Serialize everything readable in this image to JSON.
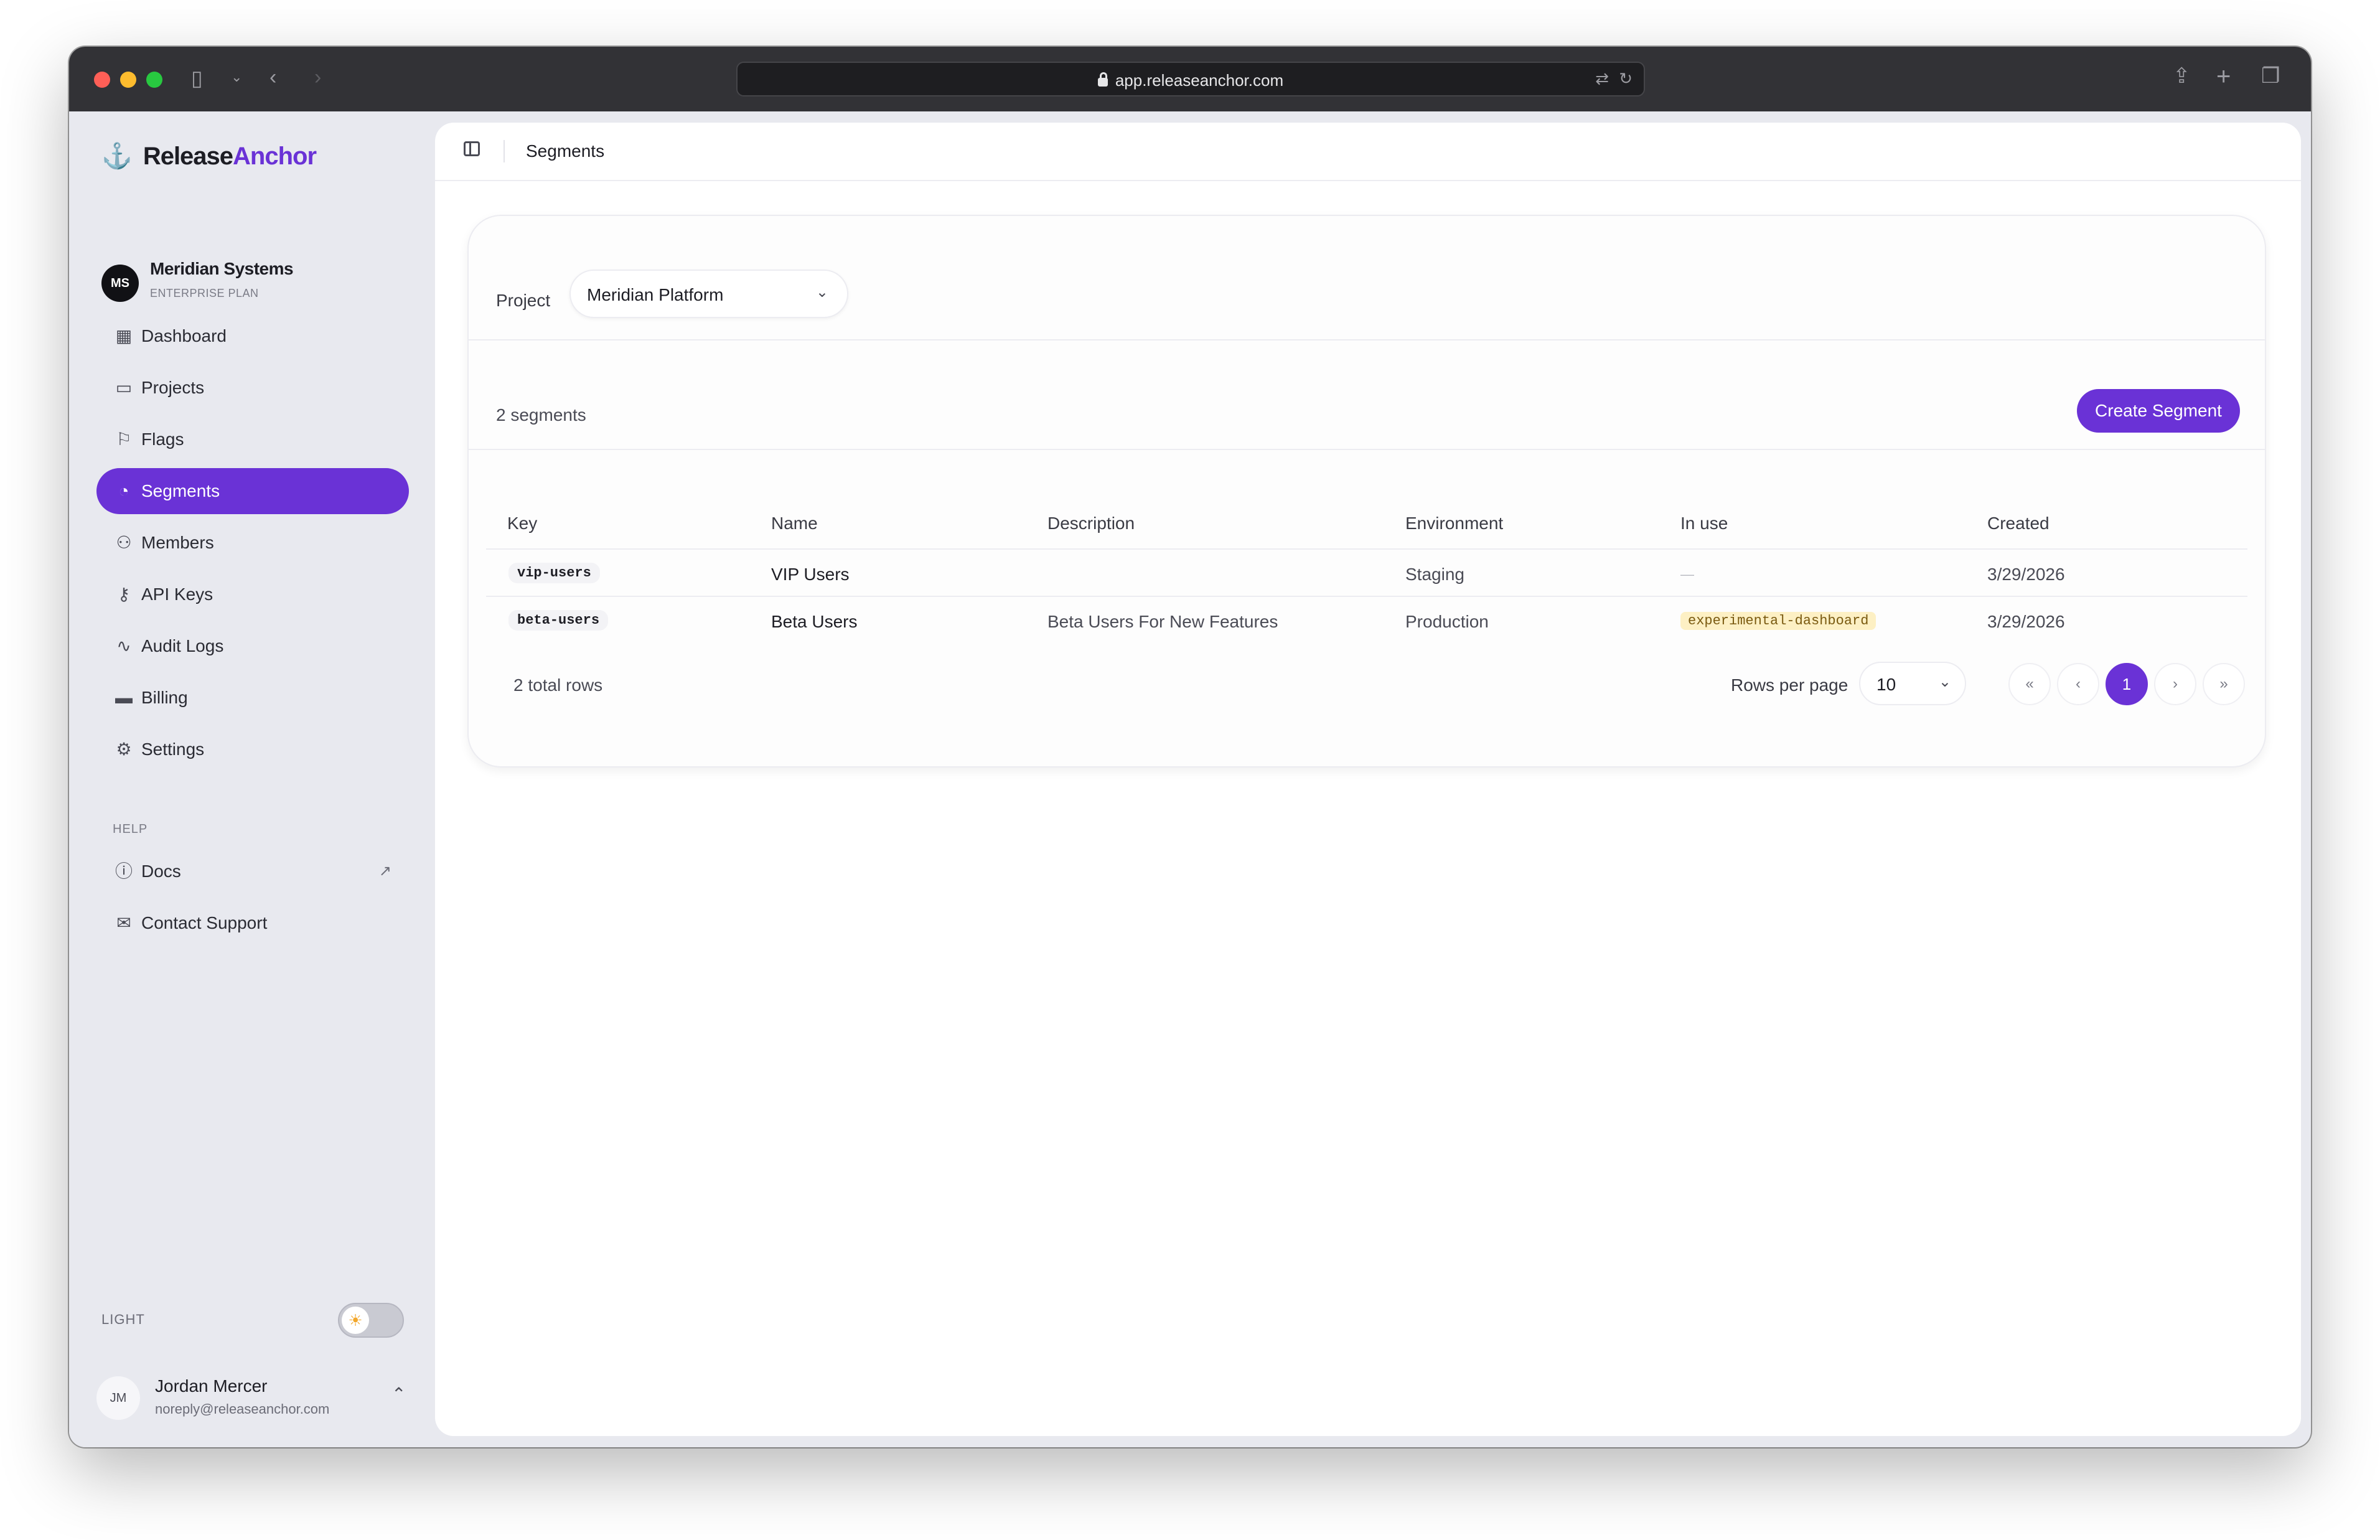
{
  "browser": {
    "url": "app.releaseanchor.com"
  },
  "sidebar": {
    "brand": {
      "part1": "Release",
      "part2": "Anchor"
    },
    "org": {
      "initials": "MS",
      "name": "Meridian Systems",
      "plan": "ENTERPRISE PLAN"
    },
    "items": [
      {
        "label": "Dashboard",
        "icon": "dashboard-icon"
      },
      {
        "label": "Projects",
        "icon": "folder-icon"
      },
      {
        "label": "Flags",
        "icon": "flag-icon"
      },
      {
        "label": "Segments",
        "icon": "pie-chart-icon",
        "active": true
      },
      {
        "label": "Members",
        "icon": "users-icon"
      },
      {
        "label": "API Keys",
        "icon": "key-icon"
      },
      {
        "label": "Audit Logs",
        "icon": "activity-icon"
      },
      {
        "label": "Billing",
        "icon": "credit-card-icon"
      },
      {
        "label": "Settings",
        "icon": "gear-icon"
      }
    ],
    "help_label": "HELP",
    "help_items": [
      {
        "label": "Docs",
        "icon": "help-circle-icon",
        "external": true
      },
      {
        "label": "Contact Support",
        "icon": "mail-icon"
      }
    ],
    "theme_label": "LIGHT",
    "user": {
      "initials": "JM",
      "name": "Jordan Mercer",
      "email": "noreply@releaseanchor.com"
    }
  },
  "header": {
    "title": "Segments"
  },
  "filters": {
    "project_label": "Project",
    "project_value": "Meridian Platform"
  },
  "segments": {
    "count_label": "2 segments",
    "create_label": "Create Segment",
    "columns": [
      "Key",
      "Name",
      "Description",
      "Environment",
      "In use",
      "Created"
    ],
    "rows": [
      {
        "key": "vip-users",
        "name": "VIP Users",
        "description": "",
        "environment": "Staging",
        "in_use": "—",
        "created": "3/29/2026"
      },
      {
        "key": "beta-users",
        "name": "Beta Users",
        "description": "Beta Users For New Features",
        "environment": "Production",
        "in_use": "experimental-dashboard",
        "created": "3/29/2026"
      }
    ],
    "total_rows": "2 total rows"
  },
  "pagination": {
    "rows_per_page_label": "Rows per page",
    "rows_per_page": "10",
    "first": "«",
    "prev": "‹",
    "current_page": "1",
    "next": "›",
    "last": "»"
  },
  "colors": {
    "accent": "#6a32d6",
    "sidebar_bg": "#e8e9ef",
    "tag_bg": "#fdf0c4"
  }
}
